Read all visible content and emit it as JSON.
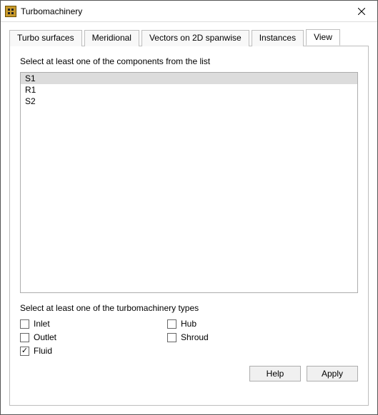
{
  "window": {
    "title": "Turbomachinery"
  },
  "tabs": [
    {
      "label": "Turbo surfaces"
    },
    {
      "label": "Meridional"
    },
    {
      "label": "Vectors on 2D spanwise"
    },
    {
      "label": "Instances"
    },
    {
      "label": "View"
    }
  ],
  "components": {
    "section_label": "Select at least one of the components from the list",
    "items": [
      {
        "label": "S1"
      },
      {
        "label": "R1"
      },
      {
        "label": "S2"
      }
    ]
  },
  "types": {
    "section_label": "Select at least one of the turbomachinery types",
    "options": {
      "inlet": {
        "label": "Inlet"
      },
      "outlet": {
        "label": "Outlet"
      },
      "fluid": {
        "label": "Fluid"
      },
      "hub": {
        "label": "Hub"
      },
      "shroud": {
        "label": "Shroud"
      }
    }
  },
  "buttons": {
    "help": "Help",
    "apply": "Apply"
  }
}
